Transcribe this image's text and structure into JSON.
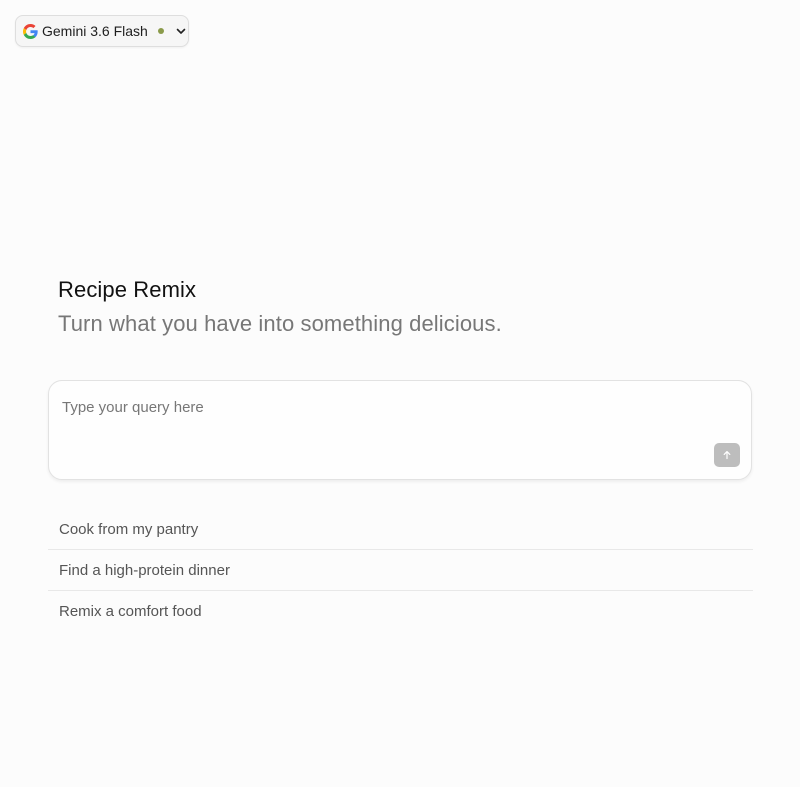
{
  "model_selector": {
    "name": "Gemini 3.6 Flash",
    "status_color": "#8a9a4a"
  },
  "hero": {
    "title": "Recipe Remix",
    "subtitle": "Turn what you have into something delicious."
  },
  "query": {
    "placeholder": "Type your query here",
    "value": ""
  },
  "icons": {
    "brand": "google-g-icon",
    "dropdown": "chevron-down-icon",
    "send": "arrow-up-icon"
  },
  "colors": {
    "send_button": "#bdbdbd",
    "background": "#fcfcfc"
  },
  "suggestions": [
    {
      "label": "Cook from my pantry"
    },
    {
      "label": "Find a high-protein dinner"
    },
    {
      "label": "Remix a comfort food"
    }
  ]
}
